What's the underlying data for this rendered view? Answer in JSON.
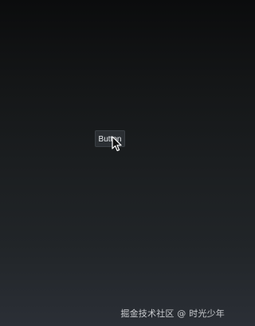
{
  "main": {
    "button_label": "Button"
  },
  "cursor": {
    "icon": "arrow-cursor-icon"
  },
  "watermark": {
    "text": "掘金技术社区 @ 时光少年"
  }
}
